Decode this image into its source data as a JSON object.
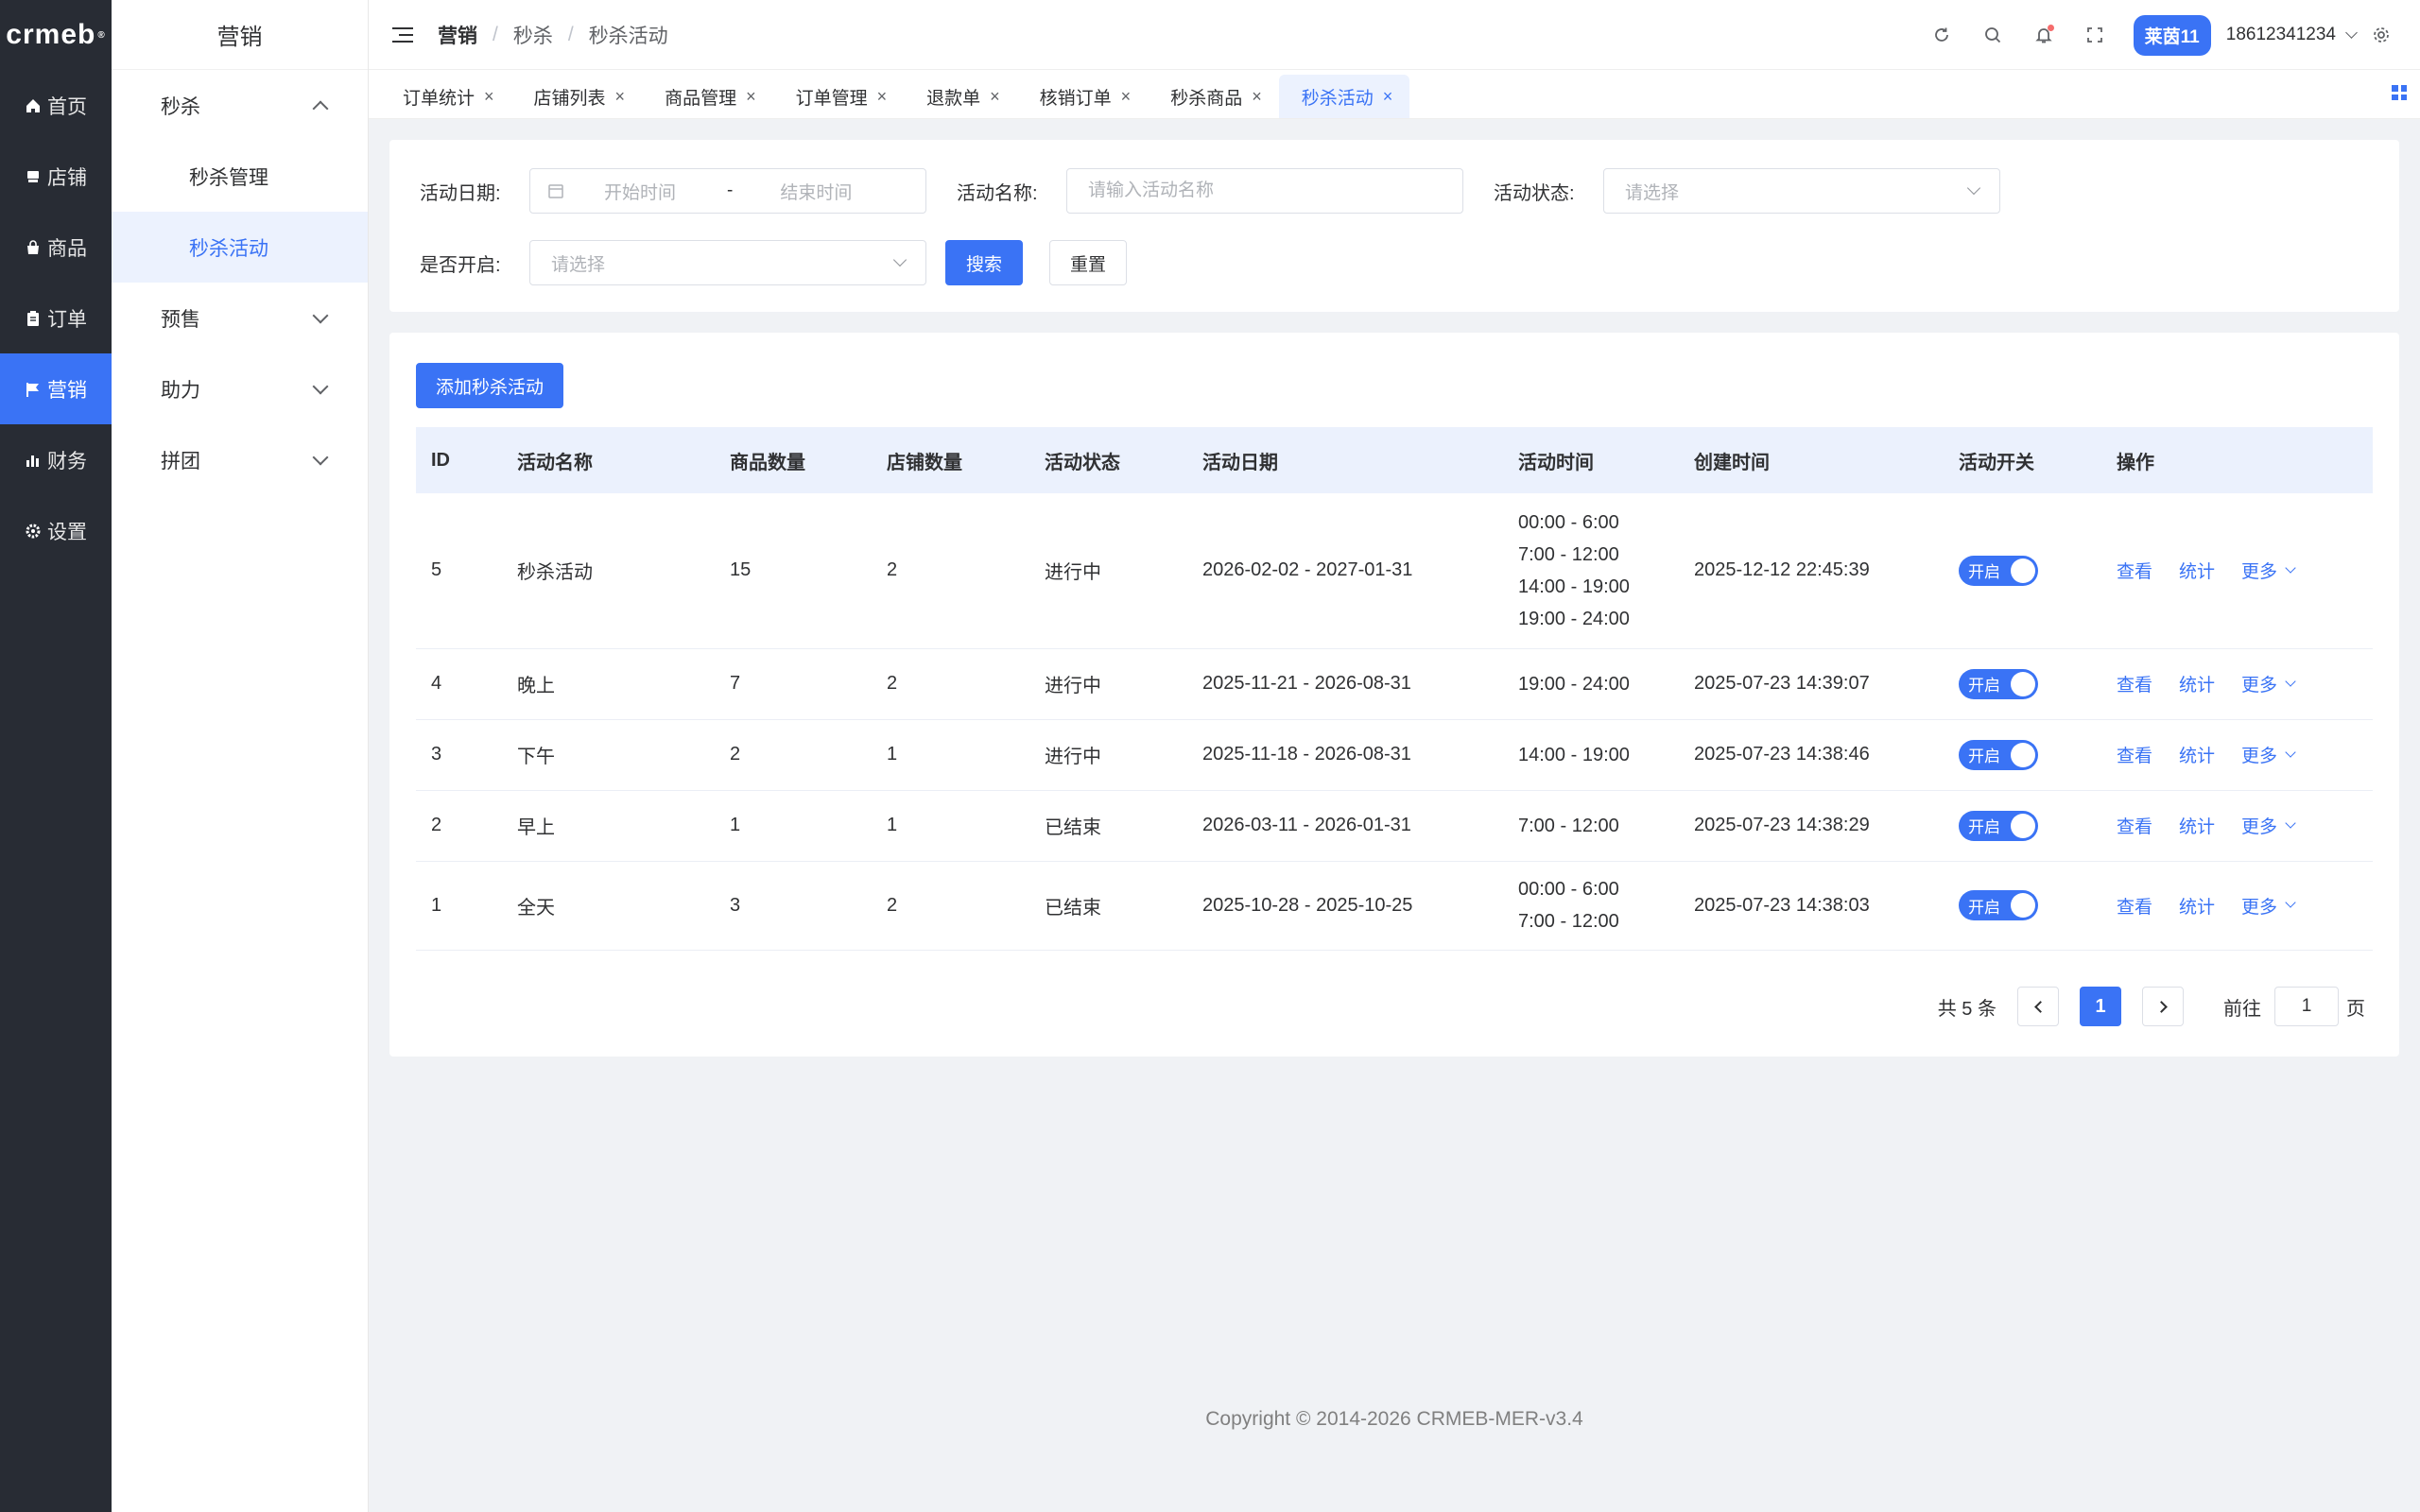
{
  "rail": {
    "logo": "crmeb",
    "logo_mark": "®",
    "items": [
      {
        "icon": "home-icon",
        "label": "首页"
      },
      {
        "icon": "store-icon",
        "label": "店铺"
      },
      {
        "icon": "bag-icon",
        "label": "商品"
      },
      {
        "icon": "clipboard-icon",
        "label": "订单"
      },
      {
        "icon": "flag-icon",
        "label": "营销"
      },
      {
        "icon": "bar-chart-icon",
        "label": "财务"
      },
      {
        "icon": "gear-icon",
        "label": "设置"
      }
    ],
    "active_index": 4
  },
  "subnav": {
    "title": "营销",
    "groups": [
      {
        "label": "秒杀",
        "children": [
          "秒杀管理",
          "秒杀活动"
        ]
      },
      {
        "label": "预售"
      },
      {
        "label": "助力"
      },
      {
        "label": "拼团"
      }
    ],
    "active_child": "秒杀活动"
  },
  "header": {
    "breadcrumb": [
      "营销",
      "秒杀",
      "秒杀活动"
    ],
    "store_badge": "莱茵11",
    "user": "18612341234"
  },
  "tabs": [
    {
      "label": "订单统计"
    },
    {
      "label": "店铺列表"
    },
    {
      "label": "商品管理"
    },
    {
      "label": "订单管理"
    },
    {
      "label": "退款单"
    },
    {
      "label": "核销订单"
    },
    {
      "label": "秒杀商品"
    },
    {
      "label": "秒杀活动",
      "active": true
    }
  ],
  "filter": {
    "date_label": "活动日期:",
    "start_placeholder": "开始时间",
    "range_sep": "-",
    "end_placeholder": "结束时间",
    "name_label": "活动名称:",
    "name_placeholder": "请输入活动名称",
    "status_label": "活动状态:",
    "status_placeholder": "请选择",
    "open_label": "是否开启:",
    "open_placeholder": "请选择",
    "search_btn": "搜索",
    "reset_btn": "重置"
  },
  "table": {
    "add_btn": "添加秒杀活动",
    "columns": [
      "ID",
      "活动名称",
      "商品数量",
      "店铺数量",
      "活动状态",
      "活动日期",
      "活动时间",
      "创建时间",
      "活动开关",
      "操作"
    ],
    "rows": [
      {
        "id": "5",
        "name": "秒杀活动",
        "goods": "15",
        "stores": "2",
        "status": "进行中",
        "date": "2026-02-02 - 2027-01-31",
        "times": [
          "00:00 - 6:00",
          "7:00 - 12:00",
          "14:00 - 19:00",
          "19:00 - 24:00"
        ],
        "created": "2025-12-12 22:45:39",
        "switch": "开启"
      },
      {
        "id": "4",
        "name": "晚上",
        "goods": "7",
        "stores": "2",
        "status": "进行中",
        "date": "2025-11-21 - 2026-08-31",
        "times": [
          "19:00 - 24:00"
        ],
        "created": "2025-07-23 14:39:07",
        "switch": "开启"
      },
      {
        "id": "3",
        "name": "下午",
        "goods": "2",
        "stores": "1",
        "status": "进行中",
        "date": "2025-11-18 - 2026-08-31",
        "times": [
          "14:00 - 19:00"
        ],
        "created": "2025-07-23 14:38:46",
        "switch": "开启"
      },
      {
        "id": "2",
        "name": "早上",
        "goods": "1",
        "stores": "1",
        "status": "已结束",
        "date": "2026-03-11 - 2026-01-31",
        "times": [
          "7:00 - 12:00"
        ],
        "created": "2025-07-23 14:38:29",
        "switch": "开启"
      },
      {
        "id": "1",
        "name": "全天",
        "goods": "3",
        "stores": "2",
        "status": "已结束",
        "date": "2025-10-28 - 2025-10-25",
        "times": [
          "00:00 - 6:00",
          "7:00 - 12:00"
        ],
        "created": "2025-07-23 14:38:03",
        "switch": "开启"
      }
    ],
    "actions": [
      "查看",
      "统计",
      "更多"
    ]
  },
  "pager": {
    "total_text": "共 5 条",
    "current": "1",
    "goto_label": "前往",
    "goto_value": "1",
    "page_suffix": "页"
  },
  "footer": "Copyright © 2014-2026 CRMEB-MER-v3.4",
  "colors": {
    "primary": "#3a73f5",
    "rail_bg": "#282c34",
    "header_row": "#ebf1fd"
  }
}
